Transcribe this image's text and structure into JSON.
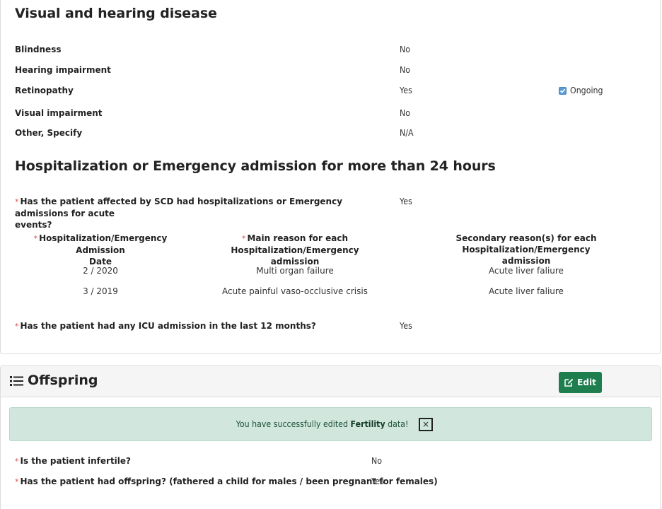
{
  "visual": {
    "title": "Visual and hearing disease",
    "rows": [
      {
        "label": "Blindness",
        "value": "No"
      },
      {
        "label": "Hearing impairment",
        "value": "No"
      },
      {
        "label": "Retinopathy",
        "value": "Yes"
      },
      {
        "label": "Visual impairment",
        "value": "No"
      },
      {
        "label": "Other, Specify",
        "value": "N/A"
      }
    ],
    "ongoing_label": "Ongoing",
    "ongoing_checked": true
  },
  "hosp": {
    "title": "Hospitalization or Emergency admission for more than 24 hours",
    "q1_label_line1": "Has the patient affected by SCD had hospitalizations or Emergency admissions for acute",
    "q1_label_line2": "events?",
    "q1_value": "Yes",
    "columns": [
      {
        "line1": "Hospitalization/Emergency Admission",
        "line2": "Date",
        "required": true
      },
      {
        "line1": "Main reason for each Hospitalization/Emergency",
        "line2": "admission",
        "required": true
      },
      {
        "line1": "Secondary reason(s) for each Hospitalization/Emergency",
        "line2": "admission",
        "required": false
      }
    ],
    "rows": [
      {
        "date": "2 / 2020",
        "main": "Multi organ failure",
        "secondary": "Acute liver faliure"
      },
      {
        "date": "3 / 2019",
        "main": "Acute painful vaso-occlusive crisis",
        "secondary": "Acute liver faliure"
      }
    ],
    "q2_label": "Has the patient had any ICU admission in the last 12 months?",
    "q2_value": "Yes"
  },
  "offspring": {
    "title": "Offspring",
    "edit_label": "Edit",
    "alert_prefix": "You have successfully edited",
    "alert_bold": "Fertility",
    "alert_suffix": "data!",
    "close_glyph": "×",
    "q1_label": "Is the patient infertile?",
    "q1_value": "No",
    "q2_label": "Has the patient had offspring? (fathered a child for males / been pregnant for females)",
    "q2_value": "Yes"
  },
  "required_mark": "*",
  "colors": {
    "edit_button": "#1e7e4e",
    "alert_bg": "#d1e7dd",
    "required": "#d9534f",
    "checkbox": "#5b9bd5"
  }
}
